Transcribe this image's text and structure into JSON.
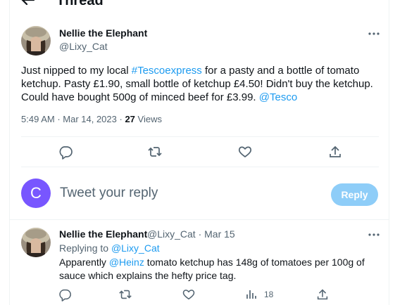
{
  "header": {
    "title": "Thread"
  },
  "tweet": {
    "author_name": "Nellie the Elephant",
    "author_handle": "@Lixy_Cat",
    "text_parts": {
      "p1": "Just nipped to my local ",
      "hashtag": "#Tescoexpress",
      "p2": " for a pasty and a bottle of tomato ketchup. Pasty £1.90, small bottle of ketchup £4.50! Didn't buy the ketchup. Could have bought 500g of minced beef for £3.99. ",
      "mention": "@Tesco"
    },
    "time": "5:49 AM",
    "date": "Mar 14, 2023",
    "views_count": "27",
    "views_label": "Views"
  },
  "reply_box": {
    "avatar_letter": "C",
    "placeholder": "Tweet your reply",
    "button_label": "Reply",
    "avatar_color": "#7856ff"
  },
  "reply": {
    "author_name": "Nellie the Elephant",
    "author_handle": "@Lixy_Cat",
    "date": "Mar 15",
    "replying_to_label": "Replying to",
    "replying_to_handle": "@Lixy_Cat",
    "text_p1": "Apparently ",
    "mention": "@Heinz",
    "text_p2": " tomato ketchup has 148g of tomatoes per 100g of sauce which explains the hefty price tag.",
    "views": "18"
  },
  "colors": {
    "accent": "#1d9bf0",
    "secondary_text": "#536471",
    "reply_button": "#8ecdf8"
  },
  "icons": [
    "back-arrow-icon",
    "more-icon",
    "reply-icon",
    "retweet-icon",
    "like-icon",
    "share-icon",
    "views-icon"
  ]
}
